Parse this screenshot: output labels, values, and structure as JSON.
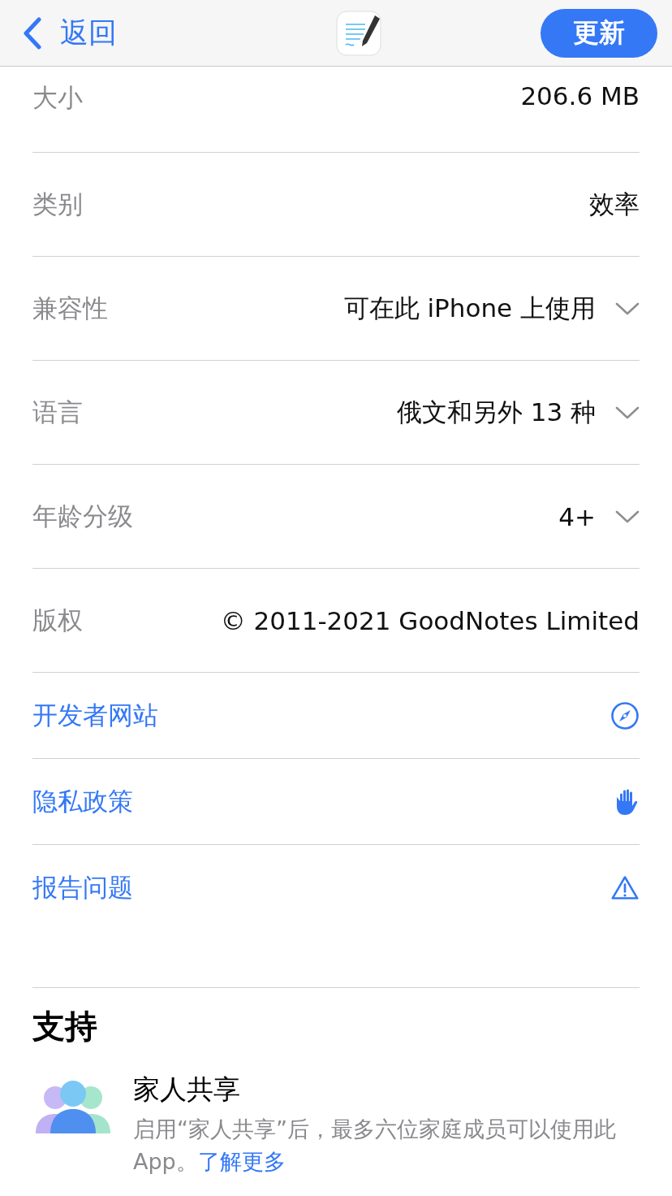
{
  "nav": {
    "back": "返回",
    "update_button": "更新"
  },
  "info_rows": [
    {
      "label": "大小",
      "value": "206.6 MB",
      "expandable": false
    },
    {
      "label": "类别",
      "value": "效率",
      "expandable": false
    },
    {
      "label": "兼容性",
      "value": "可在此 iPhone 上使用",
      "expandable": true
    },
    {
      "label": "语言",
      "value": "俄文和另外 13 种",
      "expandable": true
    },
    {
      "label": "年龄分级",
      "value": "4+",
      "expandable": true
    },
    {
      "label": "版权",
      "value": "© 2011-2021 GoodNotes Limited",
      "expandable": false
    }
  ],
  "links": [
    {
      "label": "开发者网站"
    },
    {
      "label": "隐私政策"
    },
    {
      "label": "报告问题"
    }
  ],
  "support": {
    "title": "支持",
    "family_title": "家人共享",
    "description": "启用“家人共享”后，最多六位家庭成员可以使用此 App。",
    "learn_more": "了解更多"
  }
}
